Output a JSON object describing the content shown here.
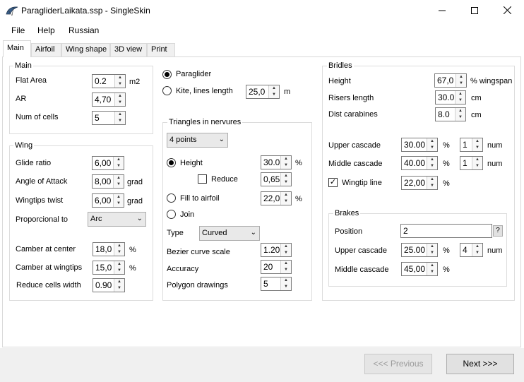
{
  "window": {
    "title": "ParagliderLaikata.ssp - SingleSkin"
  },
  "menu": {
    "file": "File",
    "help": "Help",
    "language": "Russian"
  },
  "tabs": {
    "main": "Main",
    "airfoil": "Airfoil",
    "wing_shape": "Wing shape",
    "view3d": "3D view",
    "print": "Print"
  },
  "main_group": {
    "title": "Main",
    "flat_area": {
      "label": "Flat Area",
      "value": "0.2",
      "unit": "m2"
    },
    "ar": {
      "label": "AR",
      "value": "4,70"
    },
    "num_cells": {
      "label": "Num of cells",
      "value": "5"
    }
  },
  "wing_group": {
    "title": "Wing",
    "glide_ratio": {
      "label": "Glide ratio",
      "value": "6,00"
    },
    "angle_attack": {
      "label": "Angle of Attack",
      "value": "8,00",
      "unit": "grad"
    },
    "wingtips_twist": {
      "label": "Wingtips twist",
      "value": "6,00",
      "unit": "grad"
    },
    "proportional": {
      "label": "Proporcional to",
      "value": "Arc"
    },
    "camber_center": {
      "label": "Camber at center",
      "value": "18,0",
      "unit": "%"
    },
    "camber_wingtips": {
      "label": "Camber at wingtips",
      "value": "15,0",
      "unit": "%"
    },
    "reduce_cells": {
      "label": "Reduce cells width",
      "value": "0.90"
    }
  },
  "type_select": {
    "paraglider": "Paraglider",
    "kite": "Kite, lines length",
    "kite_value": "25,0",
    "kite_unit": "m"
  },
  "triangles": {
    "title": "Triangles in nervures",
    "points": "4 points",
    "height": {
      "label": "Height",
      "value": "30.0",
      "unit": "%"
    },
    "reduce": {
      "label": "Reduce",
      "value": "0,65"
    },
    "fill": {
      "label": "Fill to airfoil",
      "value": "22,0",
      "unit": "%"
    },
    "join": "Join",
    "type": {
      "label": "Type",
      "value": "Curved"
    },
    "bezier": {
      "label": "Bezier curve scale",
      "value": "1.20"
    },
    "accuracy": {
      "label": "Accuracy",
      "value": "20"
    },
    "polygon": {
      "label": "Polygon drawings",
      "value": "5"
    }
  },
  "bridles": {
    "title": "Bridles",
    "height": {
      "label": "Height",
      "value": "67,0",
      "unit": "% wingspan"
    },
    "risers": {
      "label": "Risers length",
      "value": "30.0",
      "unit": "cm"
    },
    "carabines": {
      "label": "Dist carabines",
      "value": "8.0",
      "unit": "cm"
    },
    "upper": {
      "label": "Upper cascade",
      "value": "30.00",
      "unit": "%",
      "num": "1",
      "num_unit": "num"
    },
    "middle": {
      "label": "Middle cascade",
      "value": "40.00",
      "unit": "%",
      "num": "1",
      "num_unit": "num"
    },
    "wingtip": {
      "label": "Wingtip line",
      "value": "22,00",
      "unit": "%"
    }
  },
  "brakes": {
    "title": "Brakes",
    "position": {
      "label": "Position",
      "value": "2",
      "help": "?"
    },
    "upper": {
      "label": "Upper cascade",
      "value": "25.00",
      "unit": "%",
      "num": "4",
      "num_unit": "num"
    },
    "middle": {
      "label": "Middle cascade",
      "value": "45,00",
      "unit": "%"
    }
  },
  "nav": {
    "previous": "<<< Previous",
    "next": "Next >>>"
  }
}
